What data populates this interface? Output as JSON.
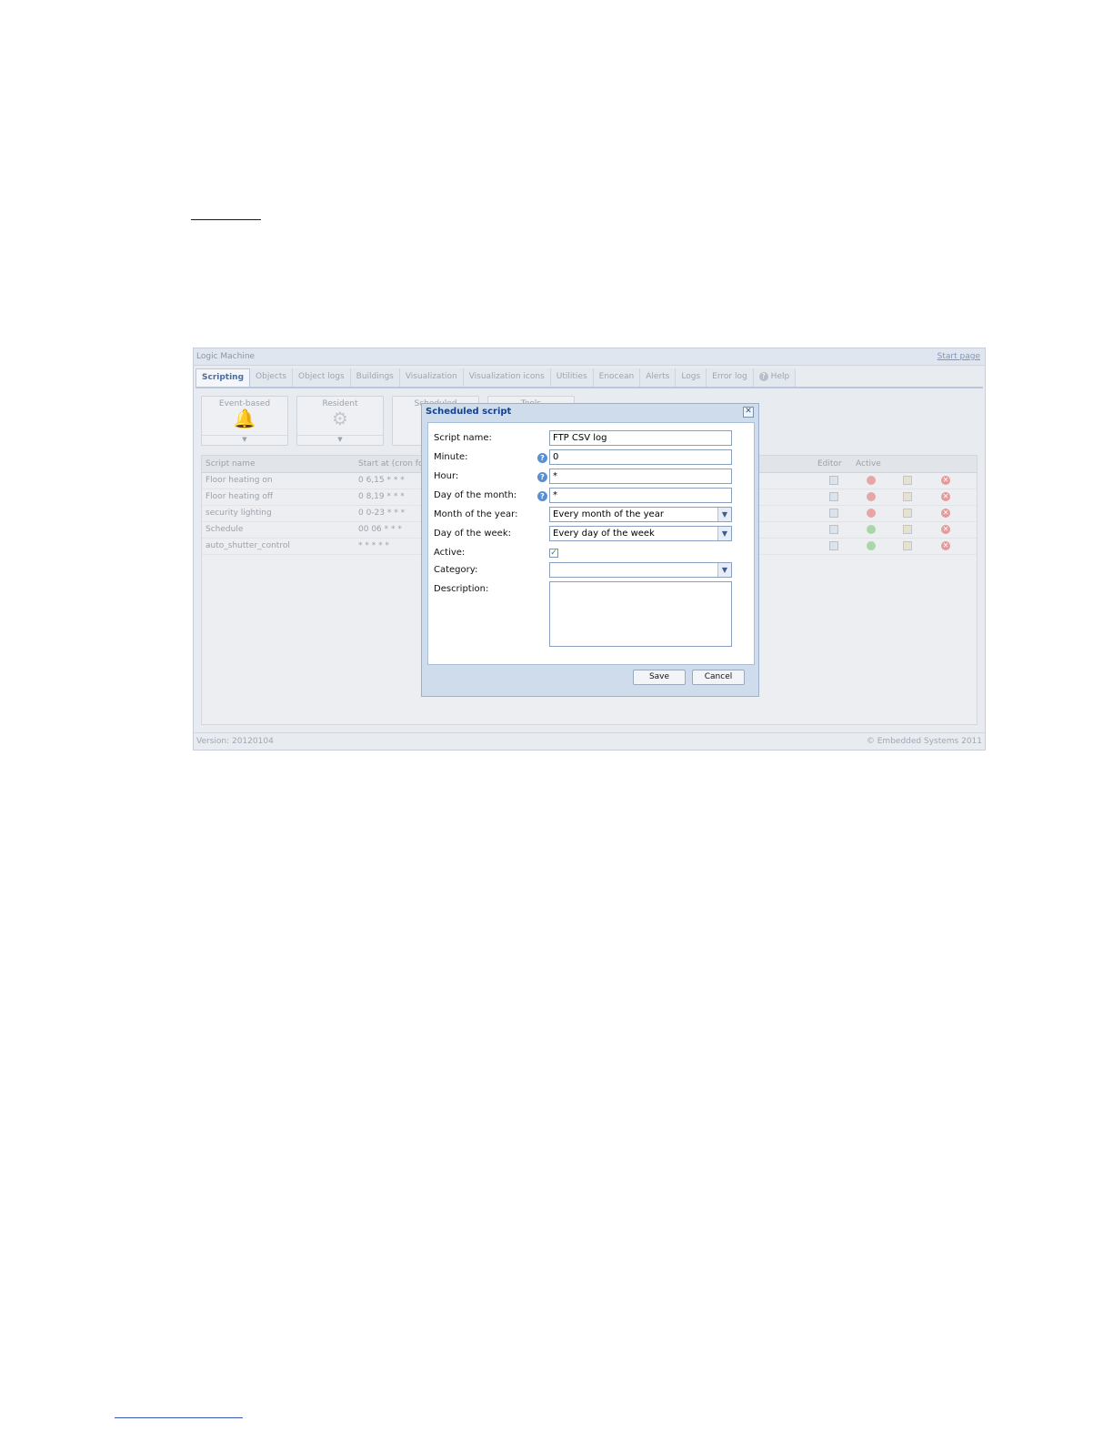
{
  "app": {
    "title": "Logic Machine",
    "start_page": "Start page",
    "version": "Version: 20120104",
    "copyright": "© Embedded Systems 2011"
  },
  "tabs": [
    {
      "label": "Scripting",
      "active": true
    },
    {
      "label": "Objects"
    },
    {
      "label": "Object logs"
    },
    {
      "label": "Buildings"
    },
    {
      "label": "Visualization"
    },
    {
      "label": "Visualization icons"
    },
    {
      "label": "Utilities"
    },
    {
      "label": "Enocean"
    },
    {
      "label": "Alerts"
    },
    {
      "label": "Logs"
    },
    {
      "label": "Error log"
    },
    {
      "label": "Help",
      "icon": "help-icon"
    }
  ],
  "toolbar": {
    "event_based": "Event-based",
    "resident": "Resident",
    "scheduled": "Scheduled",
    "tools": "Tools",
    "bell_icon": "bell-icon",
    "gear_icon": "gear-icon"
  },
  "grid": {
    "headers": {
      "script_name": "Script name",
      "start_at": "Start at (cron form",
      "editor": "Editor",
      "active": "Active"
    },
    "rows": [
      {
        "name": "Floor heating on",
        "cron": "0 6,15 * * *",
        "active": false
      },
      {
        "name": "Floor heating off",
        "cron": "0 8,19 * * *",
        "active": false
      },
      {
        "name": "security lighting",
        "cron": "0 0-23 * * *",
        "active": false
      },
      {
        "name": "Schedule",
        "cron": "00 06 * * *",
        "active": true
      },
      {
        "name": "auto_shutter_control",
        "cron": "* * * * *",
        "active": true
      }
    ]
  },
  "dialog": {
    "title": "Scheduled script",
    "close_glyph": "✕",
    "fields": {
      "script_name_label": "Script name:",
      "script_name_value": "FTP CSV log",
      "minute_label": "Minute:",
      "minute_value": "0",
      "hour_label": "Hour:",
      "hour_value": "*",
      "day_of_month_label": "Day of the month:",
      "day_of_month_value": "*",
      "month_label": "Month of the year:",
      "month_value": "Every month of the year",
      "day_of_week_label": "Day of the week:",
      "day_of_week_value": "Every day of the week",
      "active_label": "Active:",
      "active_checked": true,
      "category_label": "Category:",
      "category_value": "",
      "description_label": "Description:"
    },
    "save_label": "Save",
    "cancel_label": "Cancel",
    "help_glyph": "?",
    "dropdown_glyph": "▼",
    "check_glyph": "✓"
  }
}
